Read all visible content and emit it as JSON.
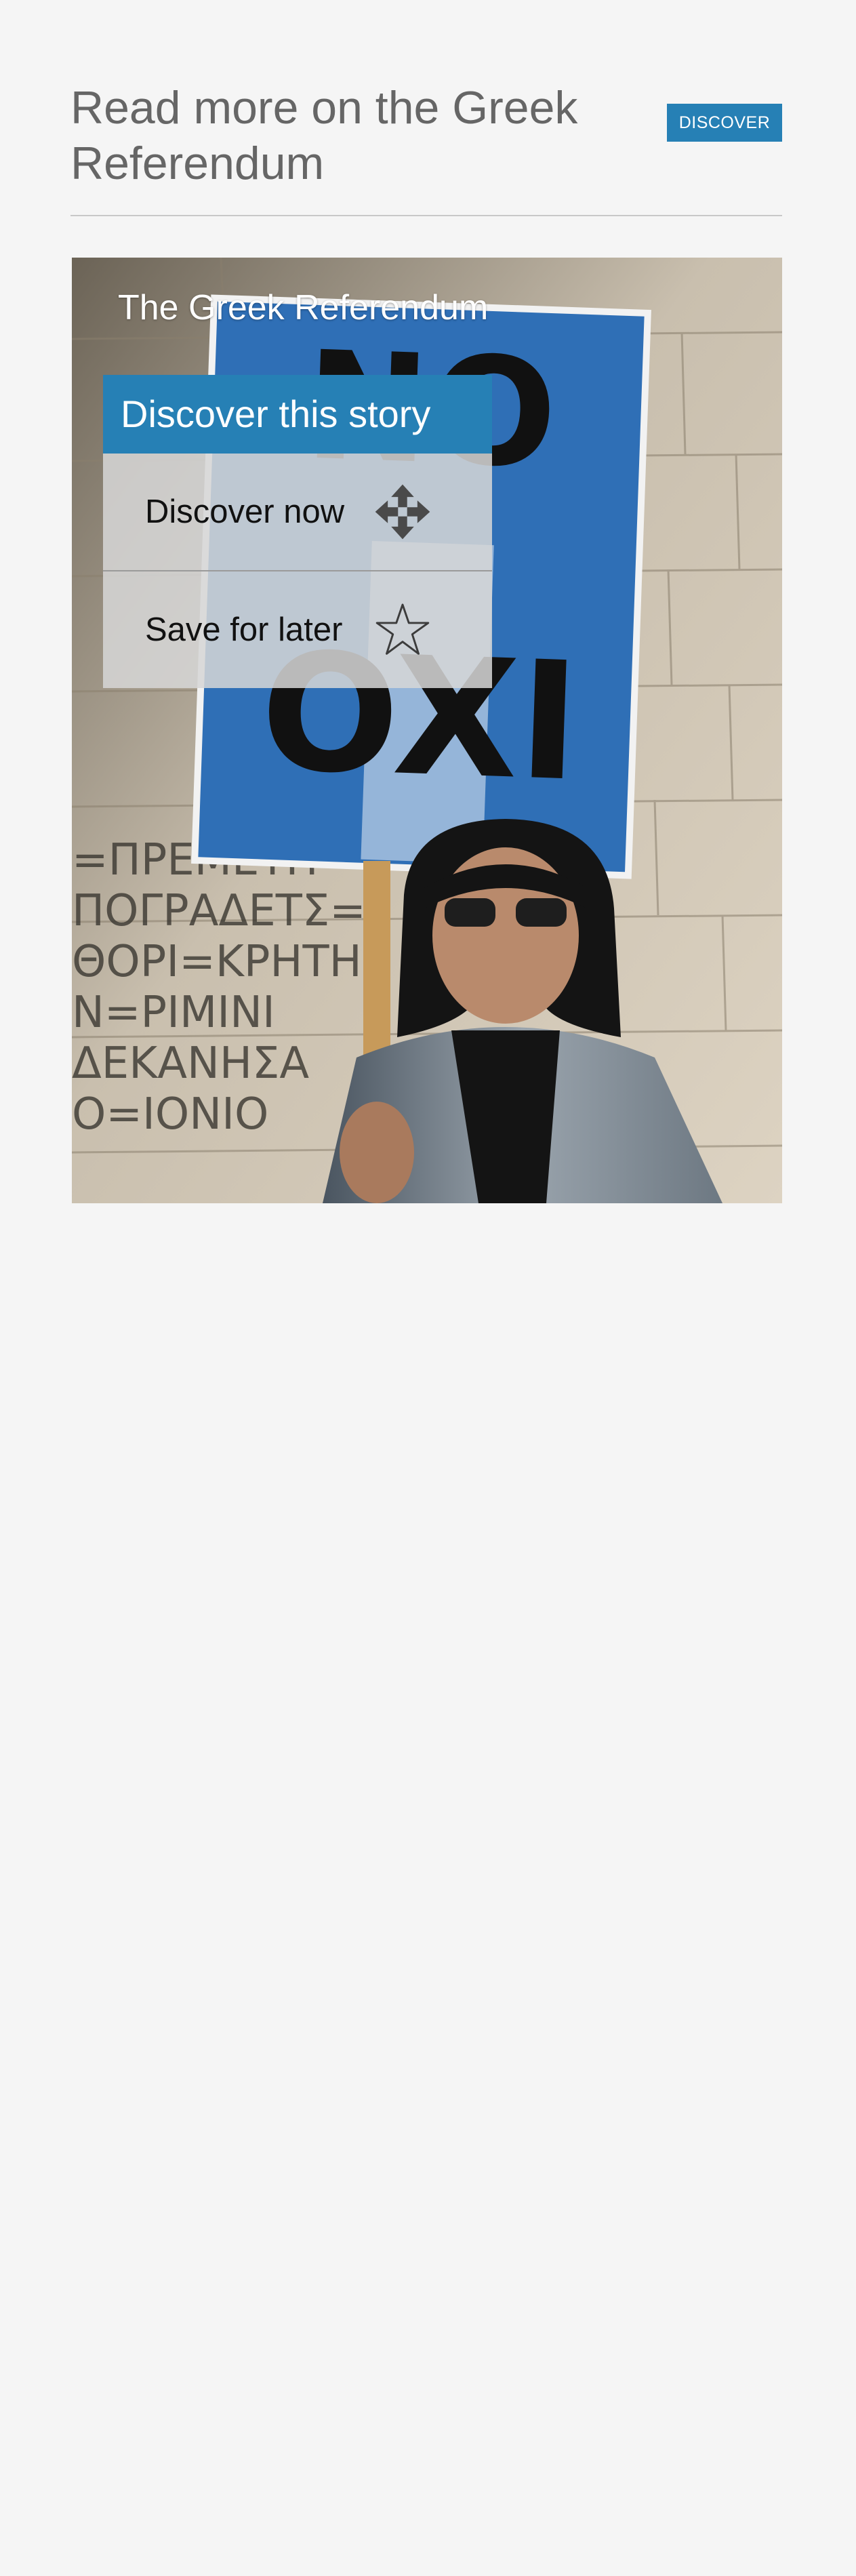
{
  "header": {
    "title": "Read more on the Greek Referendum",
    "discover_label": "DISCOVER"
  },
  "story": {
    "title": "The Greek Referendum",
    "photo_sign_top": "NO",
    "photo_sign_bottom": "OXI",
    "photo_wall_text": [
      "=ΠΡΕΜΕΤΗ",
      "ΠΟΓΡΑΔΕΤΣ=",
      "ΘΟΡΙ=ΚΡΗΤΗ",
      "Ν=ΡΙΜΙΝΙ",
      "ΔΕΚΑΝΗΣΑ",
      "Ο=ΙΟΝΙΟ"
    ]
  },
  "menu": {
    "header": "Discover this story",
    "items": [
      {
        "label": "Discover now",
        "icon": "move-arrows-icon"
      },
      {
        "label": "Save for later",
        "icon": "star-icon"
      }
    ]
  },
  "colors": {
    "accent": "#2680b5",
    "page_background": "#f5f5f5",
    "title_text": "#666666",
    "sign_blue": "#2f6fb6"
  }
}
